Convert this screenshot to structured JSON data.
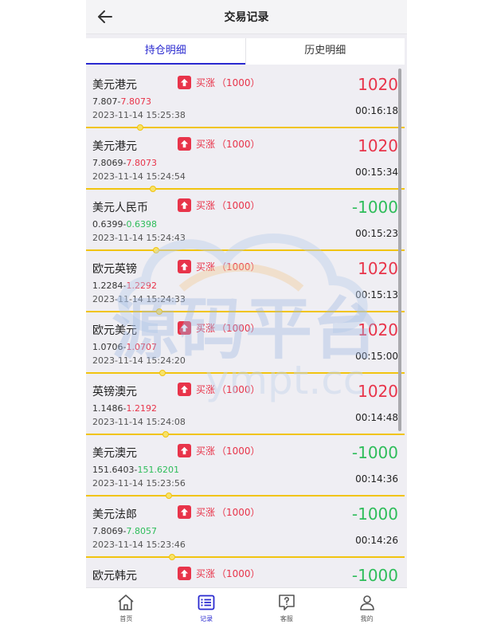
{
  "header": {
    "title": "交易记录"
  },
  "tabs": [
    {
      "label": "持仓明细",
      "active": true
    },
    {
      "label": "历史明细",
      "active": false
    }
  ],
  "colors": {
    "up": "#e8344a",
    "down": "#2ebd5a",
    "accent": "#2a2ad0",
    "divider": "#f1c40f"
  },
  "trades": [
    {
      "pair": "美元港元",
      "direction": "买涨",
      "amount": "（1000）",
      "pnl": "1020",
      "open": "7.807",
      "close": "7.8073",
      "datetime": "2023-11-14 15:25:38",
      "timer": "00:16:18",
      "progress": 0.17
    },
    {
      "pair": "美元港元",
      "direction": "买涨",
      "amount": "（1000）",
      "pnl": "1020",
      "open": "7.8069",
      "close": "7.8073",
      "datetime": "2023-11-14 15:24:54",
      "timer": "00:15:34",
      "progress": 0.21
    },
    {
      "pair": "美元人民币",
      "direction": "买涨",
      "amount": "（1000）",
      "pnl": "-1000",
      "open": "0.6399",
      "close": "0.6398",
      "datetime": "2023-11-14 15:24:43",
      "timer": "00:15:23",
      "progress": 0.22
    },
    {
      "pair": "欧元英镑",
      "direction": "买涨",
      "amount": "（1000）",
      "pnl": "1020",
      "open": "1.2284",
      "close": "1.2292",
      "datetime": "2023-11-14 15:24:33",
      "timer": "00:15:13",
      "progress": 0.23
    },
    {
      "pair": "欧元美元",
      "direction": "买涨",
      "amount": "（1000）",
      "pnl": "1020",
      "open": "1.0706",
      "close": "1.0707",
      "datetime": "2023-11-14 15:24:20",
      "timer": "00:15:00",
      "progress": 0.24
    },
    {
      "pair": "英镑澳元",
      "direction": "买涨",
      "amount": "（1000）",
      "pnl": "1020",
      "open": "1.1486",
      "close": "1.2192",
      "datetime": "2023-11-14 15:24:08",
      "timer": "00:14:48",
      "progress": 0.25
    },
    {
      "pair": "美元澳元",
      "direction": "买涨",
      "amount": "（1000）",
      "pnl": "-1000",
      "open": "151.6403",
      "close": "151.6201",
      "datetime": "2023-11-14 15:23:56",
      "timer": "00:14:36",
      "progress": 0.26
    },
    {
      "pair": "美元法郎",
      "direction": "买涨",
      "amount": "（1000）",
      "pnl": "-1000",
      "open": "7.8069",
      "close": "7.8057",
      "datetime": "2023-11-14 15:23:46",
      "timer": "00:14:26",
      "progress": 0.27
    },
    {
      "pair": "欧元韩元",
      "direction": "买涨",
      "amount": "（1000）",
      "pnl": "-1000",
      "open": "",
      "close": "",
      "datetime": "",
      "timer": "",
      "progress": 0.28
    }
  ],
  "watermark": {
    "text_cn": "源码平台",
    "text_en": "ympt.cc"
  },
  "tabbar": [
    {
      "label": "首页",
      "icon": "home-icon",
      "active": false
    },
    {
      "label": "记录",
      "icon": "list-icon",
      "active": true
    },
    {
      "label": "客服",
      "icon": "help-icon",
      "active": false
    },
    {
      "label": "我的",
      "icon": "user-icon",
      "active": false
    }
  ]
}
